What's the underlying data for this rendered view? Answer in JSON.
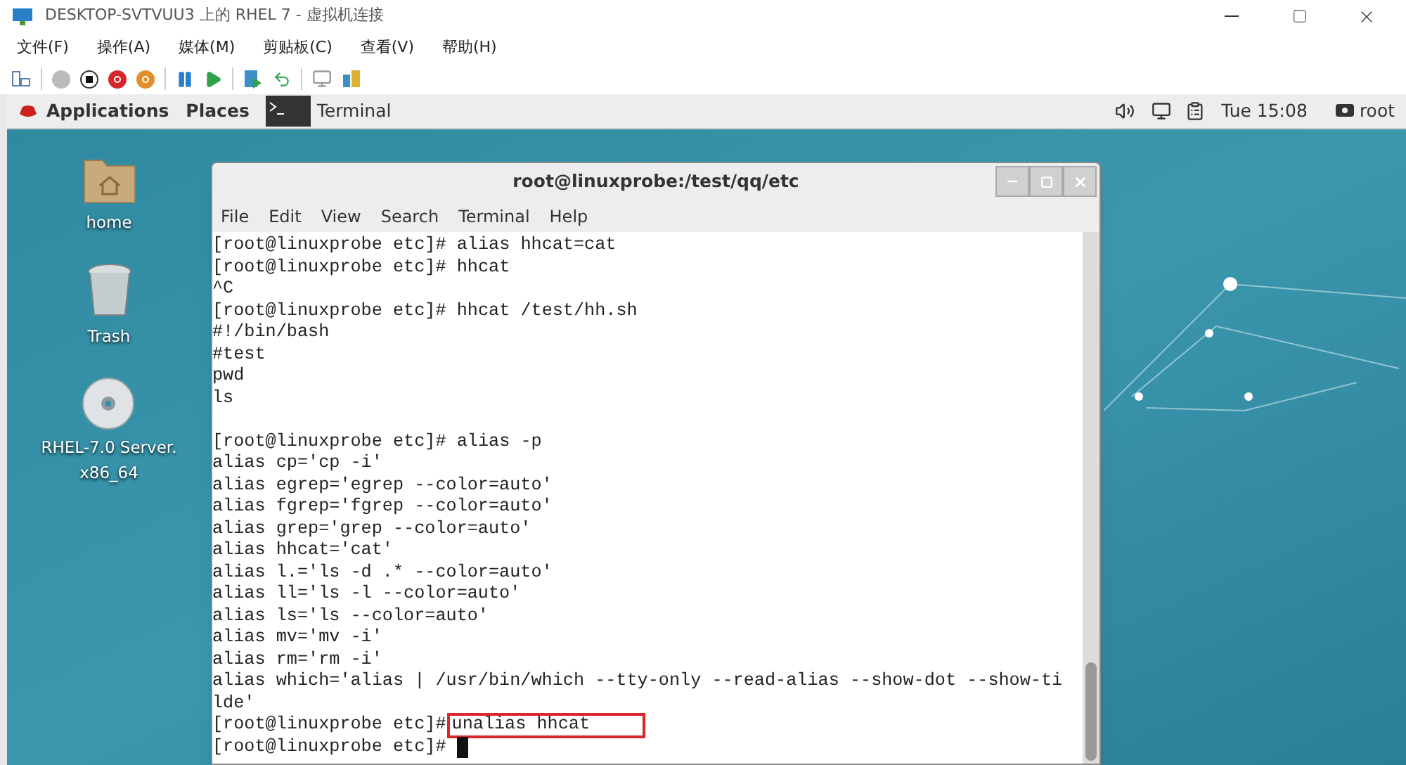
{
  "host_window": {
    "title": "DESKTOP-SVTVUU3 上的 RHEL 7 - 虚拟机连接",
    "menu": [
      "文件(F)",
      "操作(A)",
      "媒体(M)",
      "剪贴板(C)",
      "查看(V)",
      "帮助(H)"
    ]
  },
  "top_bar": {
    "applications": "Applications",
    "places": "Places",
    "task": "Terminal",
    "clock": "Tue 15:08",
    "user": "root"
  },
  "desktop_icons": [
    {
      "kind": "folder",
      "label": "home"
    },
    {
      "kind": "trash",
      "label": "Trash"
    },
    {
      "kind": "disc",
      "label": "RHEL-7.0 Server.\nx86_64"
    }
  ],
  "terminal": {
    "title": "root@linuxprobe:/test/qq/etc",
    "menu": [
      "File",
      "Edit",
      "View",
      "Search",
      "Terminal",
      "Help"
    ],
    "lines": [
      {
        "kind": "prompt",
        "prompt": "[root@linuxprobe etc]#",
        "command": "alias hhcat=cat",
        "boxed": false,
        "cursor": false
      },
      {
        "kind": "prompt",
        "prompt": "[root@linuxprobe etc]#",
        "command": "hhcat",
        "boxed": false,
        "cursor": false
      },
      {
        "kind": "output",
        "text": "^C"
      },
      {
        "kind": "prompt",
        "prompt": "[root@linuxprobe etc]#",
        "command": "hhcat /test/hh.sh",
        "boxed": false,
        "cursor": false
      },
      {
        "kind": "output",
        "text": "#!/bin/bash"
      },
      {
        "kind": "output",
        "text": "#test"
      },
      {
        "kind": "output",
        "text": "pwd"
      },
      {
        "kind": "output",
        "text": "ls"
      },
      {
        "kind": "blank"
      },
      {
        "kind": "prompt",
        "prompt": "[root@linuxprobe etc]#",
        "command": "alias -p",
        "boxed": false,
        "cursor": false
      },
      {
        "kind": "output",
        "text": "alias cp='cp -i'"
      },
      {
        "kind": "output",
        "text": "alias egrep='egrep --color=auto'"
      },
      {
        "kind": "output",
        "text": "alias fgrep='fgrep --color=auto'"
      },
      {
        "kind": "output",
        "text": "alias grep='grep --color=auto'"
      },
      {
        "kind": "output",
        "text": "alias hhcat='cat'"
      },
      {
        "kind": "output",
        "text": "alias l.='ls -d .* --color=auto'"
      },
      {
        "kind": "output",
        "text": "alias ll='ls -l --color=auto'"
      },
      {
        "kind": "output",
        "text": "alias ls='ls --color=auto'"
      },
      {
        "kind": "output",
        "text": "alias mv='mv -i'"
      },
      {
        "kind": "output",
        "text": "alias rm='rm -i'"
      },
      {
        "kind": "output",
        "text": "alias which='alias | /usr/bin/which --tty-only --read-alias --show-dot --show-ti"
      },
      {
        "kind": "output",
        "text": "lde'"
      },
      {
        "kind": "prompt",
        "prompt": "[root@linuxprobe etc]#",
        "command": "unalias hhcat",
        "boxed": true,
        "cursor": false
      },
      {
        "kind": "prompt",
        "prompt": "[root@linuxprobe etc]#",
        "cursor": true
      }
    ]
  }
}
